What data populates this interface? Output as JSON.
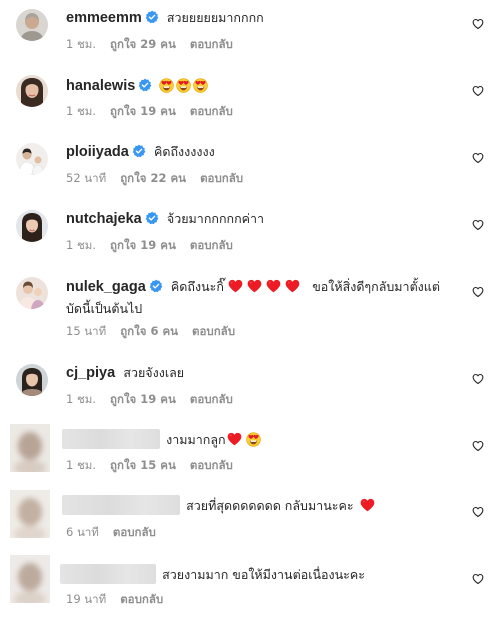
{
  "comments": [
    {
      "username": "emmeemm",
      "verified": true,
      "text": "สวยยยยยมากกกก",
      "time": "1 ชม.",
      "likes": "ถูกใจ 29 คน",
      "reply": "ตอบกลับ"
    },
    {
      "username": "hanalewis",
      "verified": true,
      "text": "",
      "time": "1 ชม.",
      "likes": "ถูกใจ 19 คน",
      "reply": "ตอบกลับ"
    },
    {
      "username": "ploiiyada",
      "verified": true,
      "text": "คิดถึงงงงงง",
      "time": "52 นาที",
      "likes": "ถูกใจ 22 คน",
      "reply": "ตอบกลับ"
    },
    {
      "username": "nutchajeka",
      "verified": true,
      "text": "จ้วยมากกกกกค่าา",
      "time": "1 ชม.",
      "likes": "ถูกใจ 19 คน",
      "reply": "ตอบกลับ"
    },
    {
      "username": "nulek_gaga",
      "verified": true,
      "text_a": "คิดถึงนะกิ๊",
      "text_b": "ขอให้สิ่งดีๆกลับมาตั้งแต่",
      "text_c": "บัดนี้เป็นต้นไป",
      "time": "15 นาที",
      "likes": "ถูกใจ 6 คน",
      "reply": "ตอบกลับ"
    },
    {
      "username": "cj_piya",
      "verified": false,
      "text": "สวยจังงเลย",
      "time": "1 ชม.",
      "likes": "ถูกใจ 19 คน",
      "reply": "ตอบกลับ"
    },
    {
      "username": "",
      "verified": false,
      "text": "งามมากลูก",
      "time": "1 ชม.",
      "likes": "ถูกใจ 15 คน",
      "reply": "ตอบกลับ"
    },
    {
      "username": "",
      "verified": false,
      "text": "สวยที่สุดดดดดดด กลับมานะคะ",
      "time": "6 นาที",
      "likes": "",
      "reply": "ตอบกลับ"
    },
    {
      "username": "",
      "verified": false,
      "text": "สวยงามมาก ขอให้มีงานต่อเนื่องนะคะ",
      "time": "19 นาที",
      "likes": "",
      "reply": "ตอบกลับ"
    }
  ],
  "colors": {
    "verified": "#3897f0",
    "heart_red": "#ed1c24",
    "meta": "#8e8e8e"
  },
  "icons": {
    "like": "heart-outline-icon",
    "verified": "verified-badge-icon",
    "emoji": "heart-eyes-emoji",
    "red_heart": "red-heart-emoji"
  }
}
